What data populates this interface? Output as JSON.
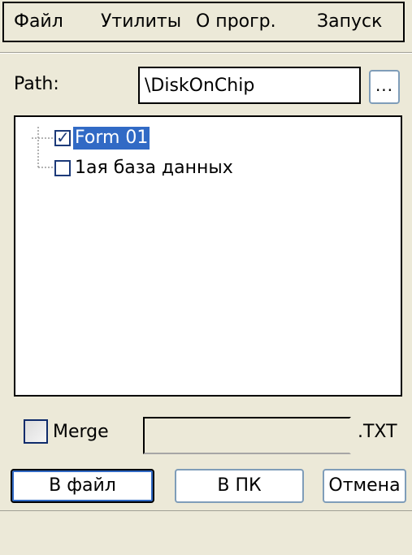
{
  "menu": {
    "items": [
      "Файл",
      "Утилиты",
      "О прогр.",
      "Запуск"
    ]
  },
  "path": {
    "label": "Path:",
    "value": "\\DiskOnChip",
    "browse_label": "..."
  },
  "tree": {
    "items": [
      {
        "label": "Form 01",
        "checked": true,
        "selected": true
      },
      {
        "label": "1ая база данных",
        "checked": false,
        "selected": false
      }
    ]
  },
  "merge": {
    "label": "Merge",
    "checked": false,
    "value": "",
    "extension": ".TXT"
  },
  "buttons": {
    "to_file": "В файл",
    "to_pc": "В ПК",
    "cancel": "Отмена"
  },
  "colors": {
    "window_bg": "#ece9d8",
    "selection": "#316ac5",
    "checkbox_border": "#1c3a79",
    "button_border": "#7f9db9"
  }
}
